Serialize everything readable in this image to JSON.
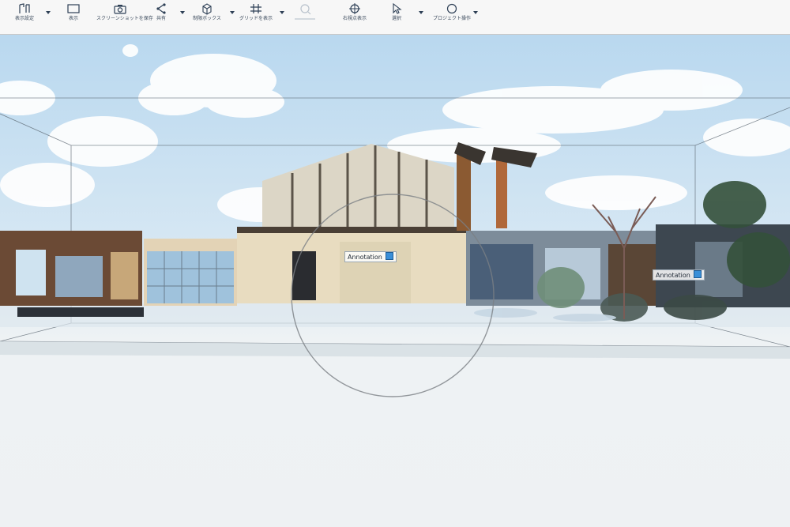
{
  "toolbar": {
    "tools": [
      {
        "id": "t1",
        "icon": "ruler-icon",
        "label": "表示設定",
        "has_menu": true
      },
      {
        "id": "t2",
        "icon": "window-icon",
        "label": "表示",
        "has_menu": false
      },
      {
        "id": "t3",
        "icon": "camera-icon",
        "label": "スクリーンショットを保存",
        "has_menu": false
      },
      {
        "id": "t4",
        "icon": "share-icon",
        "label": "共有",
        "has_menu": true
      },
      {
        "id": "t5",
        "icon": "bounding-box-icon",
        "label": "制限ボックス",
        "has_menu": true
      },
      {
        "id": "t6",
        "icon": "grid-icon",
        "label": "グリッドを表示",
        "has_menu": true
      },
      {
        "id": "t7",
        "icon": "measure-icon",
        "label": "",
        "has_menu": false,
        "disabled": true
      },
      {
        "id": "t8",
        "icon": "target-icon",
        "label": "右視点表示",
        "has_menu": false
      },
      {
        "id": "t9",
        "icon": "cursor-icon",
        "label": "選択",
        "has_menu": true
      },
      {
        "id": "t10",
        "icon": "project-icon",
        "label": "プロジェクト操作",
        "has_menu": true
      }
    ]
  },
  "viewport": {
    "annotations": [
      {
        "label": "Annotation"
      },
      {
        "label": "Annotation"
      }
    ]
  },
  "colors": {
    "sky": "#b9d8ef",
    "floor": "#eef1f3",
    "annotation_pin": "#3a8fd8"
  }
}
